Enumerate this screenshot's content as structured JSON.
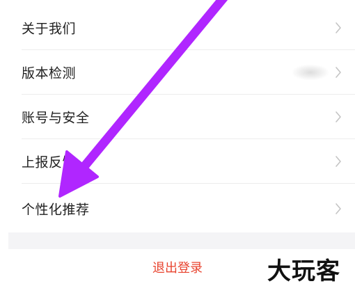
{
  "settings": {
    "items": [
      {
        "label": "关于我们"
      },
      {
        "label": "版本检测"
      },
      {
        "label": "账号与安全"
      },
      {
        "label": "上报反馈"
      },
      {
        "label": "个性化推荐"
      }
    ]
  },
  "logout": {
    "label": "退出登录"
  },
  "watermark": {
    "text": "大玩客"
  },
  "colors": {
    "logout_text": "#e8432e",
    "annotation_arrow": "#b026ff"
  }
}
